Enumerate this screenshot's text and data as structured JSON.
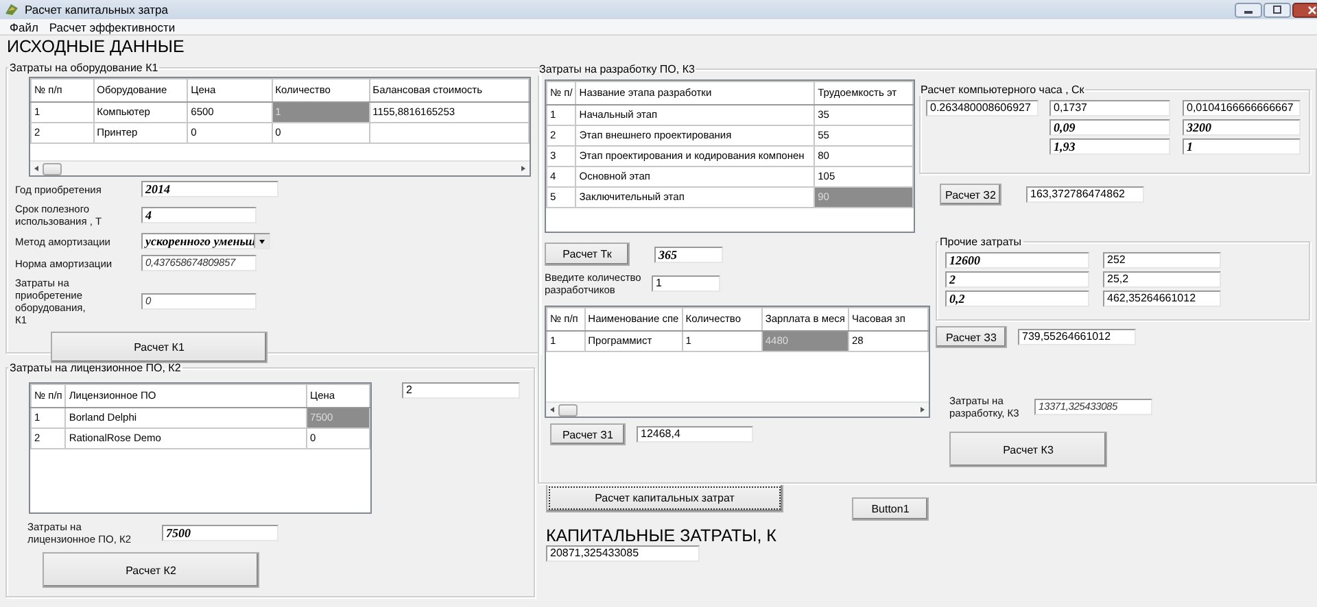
{
  "window": {
    "title": "Расчет капитальных затра"
  },
  "menu": [
    {
      "label": "Файл"
    },
    {
      "label": "Расчет эффективности"
    }
  ],
  "heading": "ИСХОДНЫЕ ДАННЫЕ",
  "equipment": {
    "title": "Затраты на оборудование  К1",
    "table": {
      "columns": [
        "№ п/п",
        "Оборудование",
        "Цена",
        "Количество",
        "Балансовая стоимость"
      ],
      "rows": [
        {
          "cells": [
            {
              "text": "1",
              "selected": false
            },
            {
              "text": "Компьютер",
              "selected": false
            },
            {
              "text": "6500",
              "selected": false
            },
            {
              "text": "1",
              "selected": true
            },
            {
              "text": "1155,8816165253",
              "selected": false
            }
          ]
        },
        {
          "cells": [
            {
              "text": "2",
              "selected": false
            },
            {
              "text": "Принтер",
              "selected": false
            },
            {
              "text": "0",
              "selected": false
            },
            {
              "text": "0",
              "selected": false
            },
            {
              "selected": false
            }
          ]
        }
      ]
    },
    "fields": [
      {
        "label": "Год приобретения",
        "value": "2014",
        "kind": "input"
      },
      {
        "label": "Срок полезного использования , Т",
        "value": "4",
        "kind": "input"
      },
      {
        "label": "Метод амортизации",
        "value": "ускоренного уменьш",
        "kind": "dropdown"
      },
      {
        "label": "Норма амортизации",
        "value": "0,437658674809857",
        "kind": "result"
      },
      {
        "label": "Затраты на приобретение оборудования, К1",
        "value": "0",
        "kind": "result"
      }
    ],
    "button": "Расчет К1"
  },
  "license": {
    "title": "Затраты на лицензионное ПО, К2",
    "table": {
      "columns": [
        "№ п/п",
        "Лицензионное ПО",
        "Цена"
      ],
      "rows": [
        {
          "cells": [
            {
              "text": "1",
              "selected": false
            },
            {
              "text": "Borland Delphi",
              "selected": false
            },
            {
              "text": "7500",
              "selected": true
            }
          ]
        },
        {
          "cells": [
            {
              "text": "2",
              "selected": false
            },
            {
              "text": "RationalRose Demo",
              "selected": false
            },
            {
              "text": "0",
              "selected": false
            }
          ]
        }
      ]
    },
    "count": {
      "value": "2",
      "kind": "output"
    },
    "total_label": "Затраты на лицензионное ПО, К2",
    "total": {
      "value": "7500",
      "kind": "input"
    },
    "button": "Расчет К2"
  },
  "development": {
    "title": "Затраты на разработку ПО, К3",
    "stages": {
      "columns": [
        "№ п/",
        "Название этапа разработки",
        "Трудоемкость эт"
      ],
      "rows": [
        {
          "cells": [
            {
              "text": "1",
              "selected": false
            },
            {
              "text": "Начальный этап",
              "selected": false
            },
            {
              "text": "35",
              "selected": false
            }
          ]
        },
        {
          "cells": [
            {
              "text": "2",
              "selected": false
            },
            {
              "text": "Этап внешнего проектирования",
              "selected": false
            },
            {
              "text": "55",
              "selected": false
            }
          ]
        },
        {
          "cells": [
            {
              "text": "3",
              "selected": false
            },
            {
              "text": "Этап проектирования и кодирования компонен",
              "selected": false
            },
            {
              "text": "80",
              "selected": false
            }
          ]
        },
        {
          "cells": [
            {
              "text": "4",
              "selected": false
            },
            {
              "text": "Основной этап",
              "selected": false
            },
            {
              "text": "105",
              "selected": false
            }
          ]
        },
        {
          "cells": [
            {
              "text": "5",
              "selected": false
            },
            {
              "text": "Заключительный этап",
              "selected": false
            },
            {
              "text": "90",
              "selected": true
            }
          ]
        }
      ]
    },
    "tk_button": "Расчет Тк",
    "tk": {
      "value": "365",
      "kind": "input"
    },
    "developers_label": "Введите количество разработчиков",
    "developers": {
      "value": "1",
      "kind": "output"
    },
    "staff": {
      "columns": [
        "№ п/п",
        "Наименование спе",
        "Количество",
        "Зарплата в меся",
        "Часовая зп"
      ],
      "rows": [
        {
          "cells": [
            {
              "text": "1",
              "selected": false
            },
            {
              "text": "Программист",
              "selected": false
            },
            {
              "text": "1",
              "selected": false
            },
            {
              "text": "4480",
              "selected": true
            },
            {
              "text": "28",
              "selected": false
            }
          ]
        }
      ]
    },
    "z1_button": "Расчет З1",
    "z1": {
      "value": "12468,4",
      "kind": "output"
    },
    "computer_hour": {
      "title": "Расчет компьютерного часа , Ск",
      "result": {
        "value": "0.263480008606927",
        "kind": "output"
      },
      "columns": [
        [
          {
            "value": "0,1737",
            "kind": "output"
          },
          {
            "value": "0,09",
            "kind": "input"
          },
          {
            "value": "1,93",
            "kind": "input"
          }
        ],
        [
          {
            "value": "0,0104166666666667",
            "kind": "output"
          },
          {
            "value": "3200",
            "kind": "input"
          },
          {
            "value": "1",
            "kind": "input"
          }
        ]
      ]
    },
    "z2_button": "Расчет З2",
    "z2": {
      "value": "163,372786474862",
      "kind": "output"
    },
    "other": {
      "title": "Прочие затраты",
      "rows": [
        [
          {
            "value": "12600",
            "kind": "input"
          },
          {
            "value": "252",
            "kind": "output"
          }
        ],
        [
          {
            "value": "2",
            "kind": "input"
          },
          {
            "value": "25,2",
            "kind": "output"
          }
        ],
        [
          {
            "value": "0,2",
            "kind": "input"
          },
          {
            "value": "462,35264661012",
            "kind": "output"
          }
        ]
      ]
    },
    "z3_button": "Расчет З3",
    "z3": {
      "value": "739,55264661012",
      "kind": "output"
    },
    "total_label": "Затраты на разработку, К3",
    "total": {
      "value": "13371,325433085",
      "kind": "result"
    },
    "button": "Расчет К3"
  },
  "capital_button": "Расчет капитальных затрат",
  "button1": "Button1",
  "capital_label": "КАПИТАЛЬНЫЕ ЗАТРАТЫ,  К",
  "capital": {
    "value": "20871,325433085",
    "kind": "output"
  }
}
